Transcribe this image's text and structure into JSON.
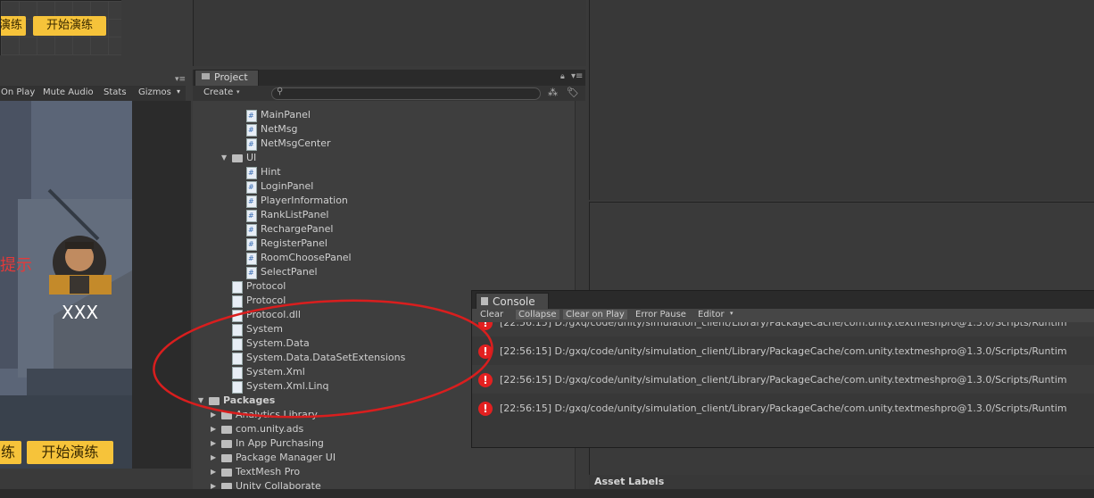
{
  "mini_view": {
    "btn_left": "演练",
    "btn_right": "开始演练"
  },
  "game_toolbar": {
    "maximize_on_play": "On Play",
    "mute_audio": "Mute Audio",
    "stats": "Stats",
    "gizmos": "Gizmos"
  },
  "game_view": {
    "hint_text": "提示",
    "player_name": "XXX",
    "btn_left": "练",
    "btn_right": "开始演练"
  },
  "project": {
    "tab_label": "Project",
    "create_label": "Create",
    "search_placeholder": "",
    "tree": [
      {
        "label": "MainPanel",
        "kind": "cs",
        "indent": 1
      },
      {
        "label": "NetMsg",
        "kind": "cs",
        "indent": 1
      },
      {
        "label": "NetMsgCenter",
        "kind": "cs",
        "indent": 1
      },
      {
        "label": "UI",
        "kind": "folder",
        "indent": 0
      },
      {
        "label": "Hint",
        "kind": "cs",
        "indent": 1
      },
      {
        "label": "LoginPanel",
        "kind": "cs",
        "indent": 1
      },
      {
        "label": "PlayerInformation",
        "kind": "cs",
        "indent": 1
      },
      {
        "label": "RankListPanel",
        "kind": "cs",
        "indent": 1
      },
      {
        "label": "RechargePanel",
        "kind": "cs",
        "indent": 1
      },
      {
        "label": "RegisterPanel",
        "kind": "cs",
        "indent": 1
      },
      {
        "label": "RoomChoosePanel",
        "kind": "cs",
        "indent": 1
      },
      {
        "label": "SelectPanel",
        "kind": "cs",
        "indent": 1
      },
      {
        "label": "Protocol",
        "kind": "file",
        "indent": 0
      },
      {
        "label": "Protocol",
        "kind": "file",
        "indent": 0
      },
      {
        "label": "Protocol.dll",
        "kind": "file",
        "indent": 0
      },
      {
        "label": "System",
        "kind": "file",
        "indent": 0
      },
      {
        "label": "System.Data",
        "kind": "file",
        "indent": 0
      },
      {
        "label": "System.Data.DataSetExtensions",
        "kind": "file",
        "indent": 0
      },
      {
        "label": "System.Xml",
        "kind": "file",
        "indent": 0
      },
      {
        "label": "System.Xml.Linq",
        "kind": "file",
        "indent": 0
      }
    ],
    "packages_label": "Packages",
    "packages": [
      "Analytics Library",
      "com.unity.ads",
      "In App Purchasing",
      "Package Manager UI",
      "TextMesh Pro",
      "Unity Collaborate"
    ]
  },
  "console": {
    "tab_label": "Console",
    "toolbar": {
      "clear": "Clear",
      "collapse": "Collapse",
      "clear_on_play": "Clear on Play",
      "error_pause": "Error Pause",
      "editor": "Editor"
    },
    "logs": [
      "[22:56:15] D:/gxq/code/unity/simulation_client/Library/PackageCache/com.unity.textmeshpro@1.3.0/Scripts/Runtim",
      "[22:56:15] D:/gxq/code/unity/simulation_client/Library/PackageCache/com.unity.textmeshpro@1.3.0/Scripts/Runtim",
      "[22:56:15] D:/gxq/code/unity/simulation_client/Library/PackageCache/com.unity.textmeshpro@1.3.0/Scripts/Runtim",
      "[22:56:15] D:/gxq/code/unity/simulation_client/Library/PackageCache/com.unity.textmeshpro@1.3.0/Scripts/Runtim"
    ],
    "error_icon": "!"
  },
  "inspector": {
    "asset_labels": "Asset Labels"
  },
  "colors": {
    "accent_yellow": "#f6c33a",
    "error_red": "#e32020",
    "annotation_red": "#d91e1e"
  }
}
